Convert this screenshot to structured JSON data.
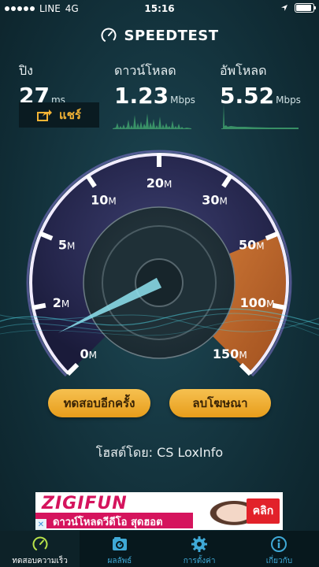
{
  "status_bar": {
    "carrier": "LINE",
    "network": "4G",
    "time": "15:16",
    "battery_level": 0.9
  },
  "header": {
    "title": "SPEEDTEST",
    "icon": "speedometer-logo-icon"
  },
  "stats": {
    "ping": {
      "label": "ปิง",
      "value": "27",
      "unit": "ms"
    },
    "download": {
      "label": "ดาวน์โหลด",
      "value": "1.23",
      "unit": "Mbps"
    },
    "upload": {
      "label": "อัพโหลด",
      "value": "5.52",
      "unit": "Mbps"
    }
  },
  "share": {
    "label": "แชร์",
    "icon": "share-icon"
  },
  "gauge": {
    "ticks": [
      {
        "num": "0",
        "unit": "M"
      },
      {
        "num": "2",
        "unit": "M"
      },
      {
        "num": "5",
        "unit": "M"
      },
      {
        "num": "10",
        "unit": "M"
      },
      {
        "num": "20",
        "unit": "M"
      },
      {
        "num": "30",
        "unit": "M"
      },
      {
        "num": "50",
        "unit": "M"
      },
      {
        "num": "100",
        "unit": "M"
      },
      {
        "num": "150",
        "unit": "M"
      }
    ],
    "colors": {
      "download_arc": "#7b68c9",
      "upload_arc": "#e8822d",
      "needle": "#8fe3f0"
    }
  },
  "buttons": {
    "retest": "ทดสอบอีกครั้ง",
    "remove_ads": "ลบโฆษณา"
  },
  "host": {
    "text": "โฮสต์โดย: CS LoxInfo"
  },
  "ad": {
    "brand": "ZIGIFUN",
    "subtitle": "ดาวน์โหลดวีดีโอ สุดฮอต",
    "cta": "คลิก"
  },
  "tabs": [
    {
      "label": "ทดสอบความเร็ว",
      "icon": "speedometer-icon"
    },
    {
      "label": "ผลลัพธ์",
      "icon": "results-icon"
    },
    {
      "label": "การตั้งค่า",
      "icon": "gear-icon"
    },
    {
      "label": "เกี่ยวกับ",
      "icon": "info-icon"
    }
  ]
}
